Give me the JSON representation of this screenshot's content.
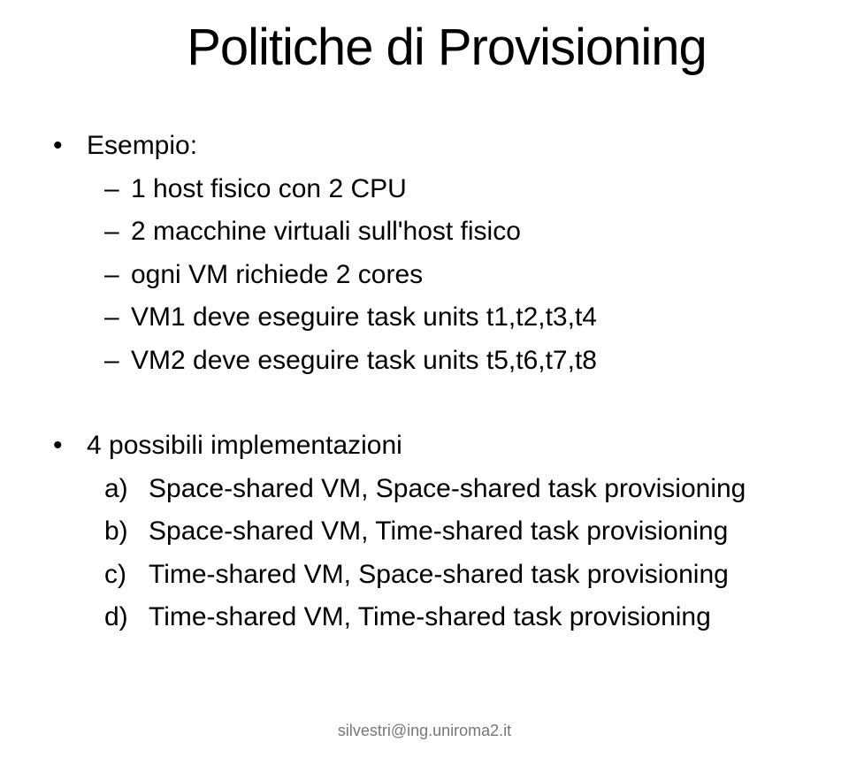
{
  "title": "Politiche di Provisioning",
  "section1": {
    "header": "Esempio:",
    "items": [
      "1 host fisico con 2 CPU",
      "2 macchine virtuali sull'host fisico",
      "ogni VM richiede 2 cores",
      "VM1 deve eseguire task units t1,t2,t3,t4",
      "VM2 deve eseguire task units t5,t6,t7,t8"
    ]
  },
  "section2": {
    "header": "4 possibili implementazioni",
    "items": [
      {
        "letter": "a)",
        "text": "Space-shared VM, Space-shared task provisioning"
      },
      {
        "letter": "b)",
        "text": "Space-shared VM, Time-shared task provisioning"
      },
      {
        "letter": "c)",
        "text": "Time-shared VM, Space-shared task provisioning"
      },
      {
        "letter": "d)",
        "text": "Time-shared VM, Time-shared task provisioning"
      }
    ]
  },
  "footer": "silvestri@ing.uniroma2.it",
  "markers": {
    "dot": "•",
    "dash": "–"
  }
}
